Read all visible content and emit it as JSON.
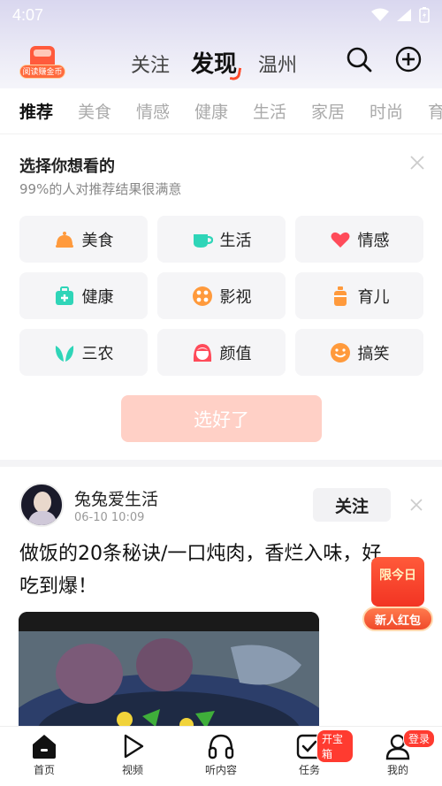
{
  "status_bar": {
    "time": "4:07"
  },
  "header": {
    "coin_badge_label": "阅读赚金币",
    "tabs": [
      {
        "label": "关注"
      },
      {
        "label": "发现"
      },
      {
        "label": "温州"
      }
    ],
    "active_tab": "发现"
  },
  "categories": [
    "推荐",
    "美食",
    "情感",
    "健康",
    "生活",
    "家居",
    "时尚",
    "育"
  ],
  "picker": {
    "title": "选择你想看的",
    "subtitle": "99%的人对推荐结果很满意",
    "chips": [
      {
        "label": "美食",
        "icon": "food-cloche-icon",
        "color": "#ff9a3c"
      },
      {
        "label": "生活",
        "icon": "cup-icon",
        "color": "#2fd5b8"
      },
      {
        "label": "情感",
        "icon": "heart-icon",
        "color": "#ff4b5a"
      },
      {
        "label": "健康",
        "icon": "medical-kit-icon",
        "color": "#2fd5b8"
      },
      {
        "label": "影视",
        "icon": "film-reel-icon",
        "color": "#ff9a3c"
      },
      {
        "label": "育儿",
        "icon": "baby-bottle-icon",
        "color": "#ff9a3c"
      },
      {
        "label": "三农",
        "icon": "leaf-icon",
        "color": "#2fd5b8"
      },
      {
        "label": "颜值",
        "icon": "girl-face-icon",
        "color": "#ff4b5a"
      },
      {
        "label": "搞笑",
        "icon": "smile-icon",
        "color": "#ff9a3c"
      }
    ],
    "confirm_label": "选好了"
  },
  "post": {
    "author": "兔兔爱生活",
    "time": "06-10 10:09",
    "follow_label": "关注",
    "title": "做饭的20条秘诀/一口炖肉，香烂入味，好吃到爆！"
  },
  "red_packet": {
    "title": "限今日",
    "label": "新人红包"
  },
  "bottom_nav": [
    {
      "label": "首页",
      "icon": "home-icon"
    },
    {
      "label": "视频",
      "icon": "play-icon"
    },
    {
      "label": "听内容",
      "icon": "headphones-icon"
    },
    {
      "label": "任务",
      "icon": "task-check-icon",
      "badge": "开宝箱"
    },
    {
      "label": "我的",
      "icon": "user-icon",
      "badge": "登录"
    }
  ],
  "colors": {
    "accent": "#ff4b2b",
    "confirm_disabled": "#ffd0c6"
  }
}
